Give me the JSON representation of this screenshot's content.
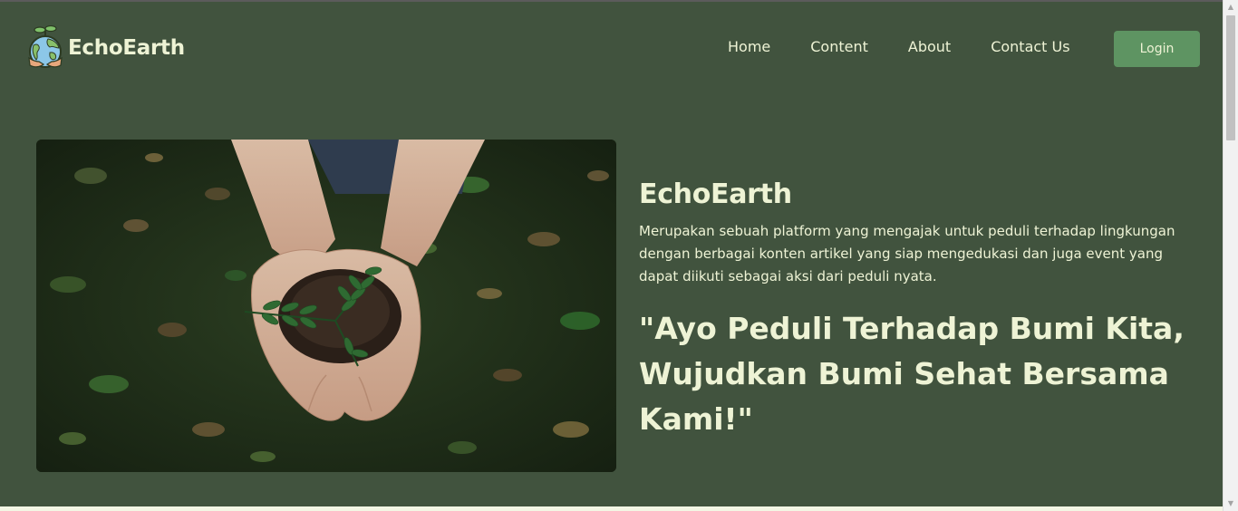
{
  "brand": {
    "name": "EchoEarth",
    "logo_icon": "globe-sprout-hands-icon"
  },
  "nav": {
    "items": [
      {
        "label": "Home"
      },
      {
        "label": "Content"
      },
      {
        "label": "About"
      },
      {
        "label": "Contact Us"
      }
    ],
    "login_label": "Login"
  },
  "hero": {
    "image_icon": "hands-holding-seedling-photo",
    "title": "EchoEarth",
    "description": "Merupakan sebuah platform yang mengajak untuk peduli terhadap lingkungan dengan berbagai konten artikel yang siap mengedukasi dan juga event yang dapat diikuti sebagai aksi dari peduli nyata.",
    "quote": "\"Ayo Peduli Terhadap Bumi Kita, Wujudkan Bumi Sehat Bersama Kami!\""
  },
  "colors": {
    "background": "#41533e",
    "text": "#eef3d5",
    "button": "#5e9462",
    "footer_strip": "#f3f6e4"
  }
}
